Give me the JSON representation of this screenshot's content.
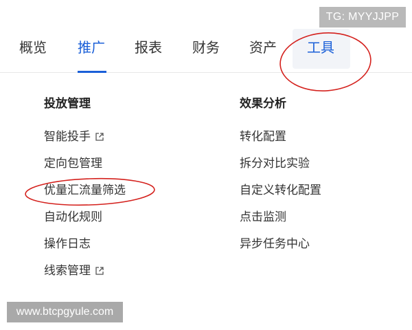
{
  "watermarks": {
    "top": "TG: MYYJJPP",
    "bottom": "www.btcpgyule.com"
  },
  "nav": {
    "tabs": [
      {
        "label": "概览"
      },
      {
        "label": "推广",
        "active": true
      },
      {
        "label": "报表"
      },
      {
        "label": "财务"
      },
      {
        "label": "资产"
      },
      {
        "label": "工具"
      }
    ],
    "accent_color": "#1a5fd8"
  },
  "menu": {
    "left": {
      "title": "投放管理",
      "items": [
        {
          "label": "智能投手",
          "external": true
        },
        {
          "label": "定向包管理"
        },
        {
          "label": "优量汇流量筛选"
        },
        {
          "label": "自动化规则"
        },
        {
          "label": "操作日志"
        },
        {
          "label": "线索管理",
          "external": true
        }
      ]
    },
    "right": {
      "title": "效果分析",
      "items": [
        {
          "label": "转化配置"
        },
        {
          "label": "拆分对比实验"
        },
        {
          "label": "自定义转化配置"
        },
        {
          "label": "点击监测"
        },
        {
          "label": "异步任务中心"
        }
      ]
    }
  },
  "annotation_color": "#d4201c"
}
